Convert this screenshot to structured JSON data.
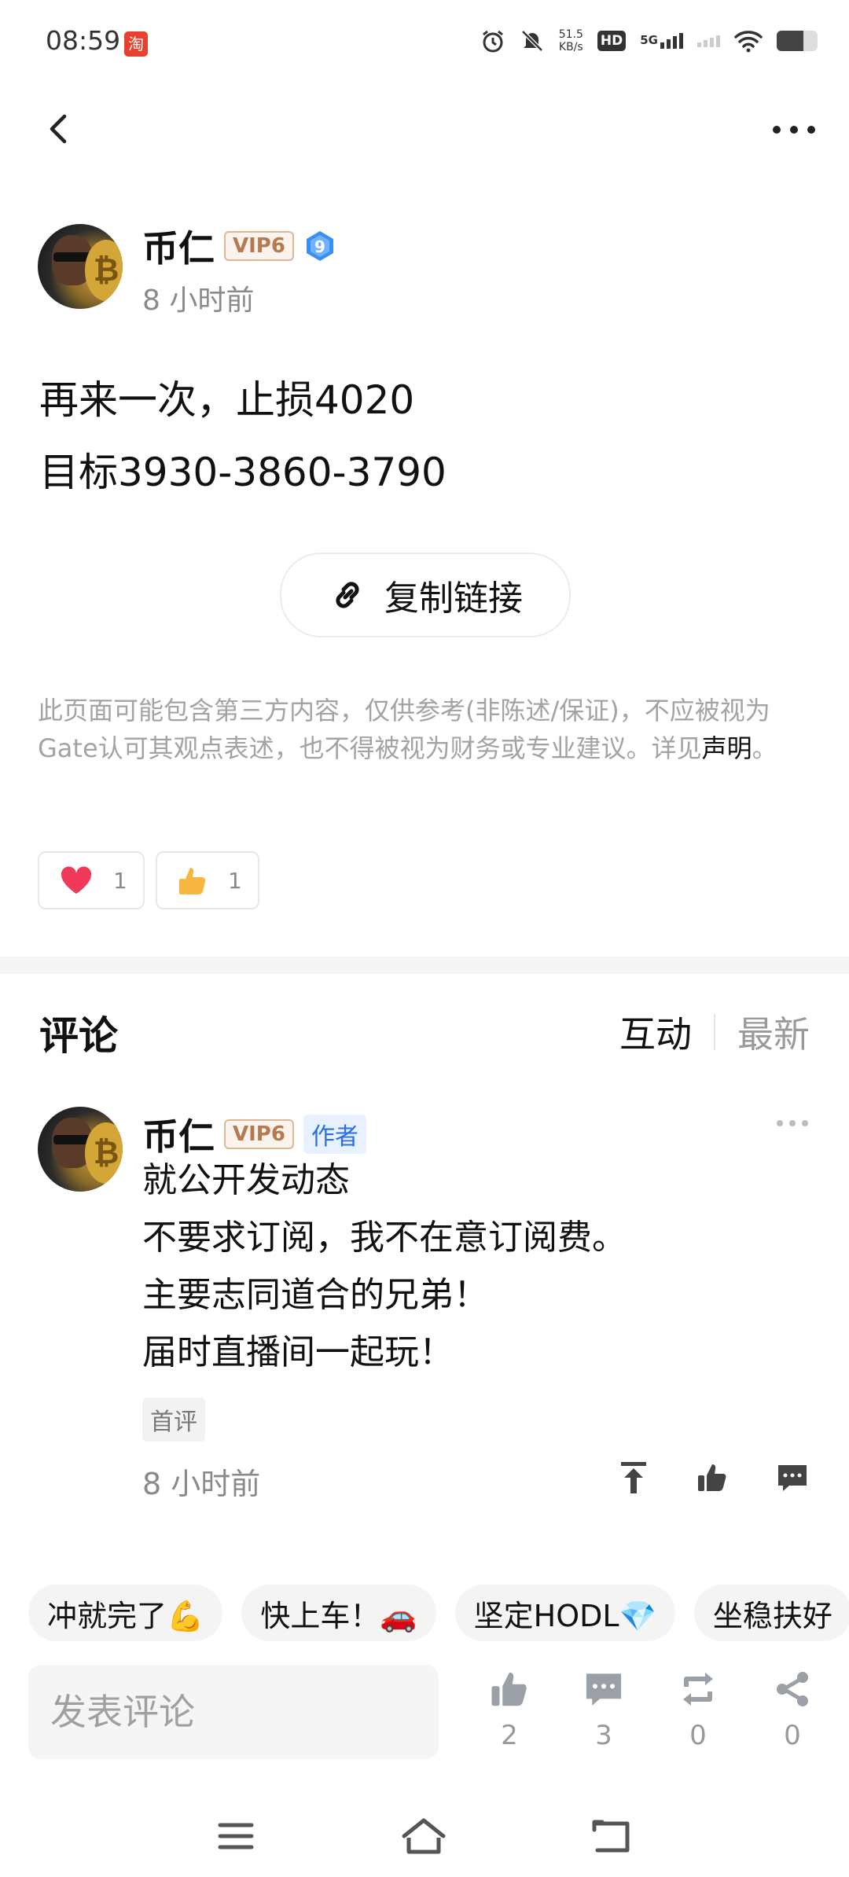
{
  "status_bar": {
    "time": "08:59",
    "taobao_glyph": "淘",
    "net_speed_value": "51.5",
    "net_speed_unit": "KB/s",
    "hd_label": "HD",
    "fiveg_label": "5G",
    "icons": [
      "alarm-icon",
      "mute-icon",
      "hd-icon",
      "signal-icon",
      "wifi-icon",
      "battery-icon"
    ]
  },
  "nav": {
    "back_icon": "chevron-left-icon",
    "more_icon": "more-icon"
  },
  "post": {
    "author": "币仁",
    "vip": "VIP6",
    "level": "9",
    "time_ago": "8 小时前",
    "lines": [
      "再来一次，止损4020",
      "目标3930-3860-3790"
    ],
    "copy_link": "复制链接"
  },
  "disclaimer": {
    "text": "此页面可能包含第三方内容，仅供参考(非陈述/保证)，不应被视为Gate认可其观点表述，也不得被视为财务或专业建议。详见",
    "link": "声明",
    "end": "。"
  },
  "reactions": [
    {
      "icon": "heart-icon",
      "count": "1"
    },
    {
      "icon": "thumb-up-emoji-icon",
      "count": "1"
    }
  ],
  "comments_section": {
    "title": "评论",
    "sort_active": "互动",
    "sort_inactive": "最新"
  },
  "comment": {
    "author": "币仁",
    "vip": "VIP6",
    "author_tag": "作者",
    "lines": [
      "就公开发动态",
      "不要求订阅，我不在意订阅费。",
      "主要志同道合的兄弟！",
      "届时直播间一起玩！"
    ],
    "first_tag": "首评",
    "time_ago": "8 小时前"
  },
  "quick_replies": [
    "冲就完了💪",
    "快上车！🚗",
    "坚定HODL💎",
    "坐稳扶好"
  ],
  "bottom_bar": {
    "input_placeholder": "发表评论",
    "like_count": "2",
    "comment_count": "3",
    "repost_count": "0",
    "share_count": "0"
  },
  "colors": {
    "vip_text": "#b77a4f",
    "author_tag": "#2a6fe0",
    "heart": "#f0385a",
    "level_badge": "#3a8ef6"
  }
}
